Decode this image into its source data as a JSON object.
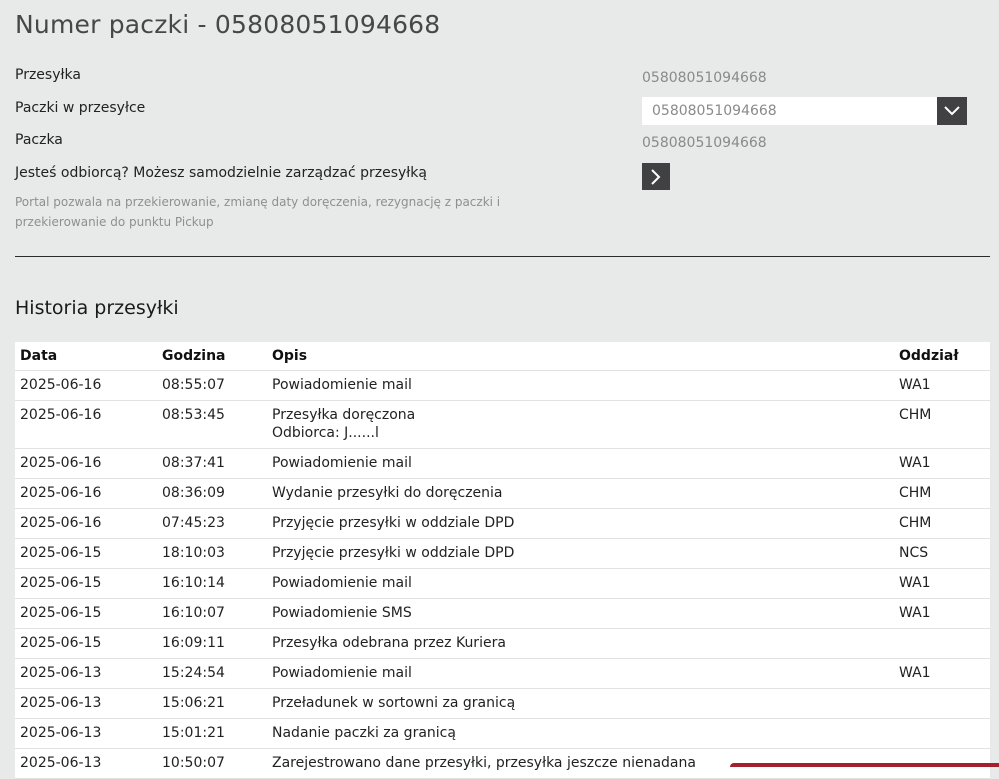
{
  "header": {
    "title": "Numer paczki - 05808051094668"
  },
  "info": {
    "shipment_label": "Przesyłka",
    "shipment_value": "05808051094668",
    "parcels_label": "Paczki w przesyłce",
    "parcels_selected": "05808051094668",
    "parcel_label": "Paczka",
    "parcel_value": "05808051094668",
    "recipient_label": "Jesteś odbiorcą? Możesz samodzielnie zarządzać przesyłką",
    "hint": "Portal pozwala na przekierowanie, zmianę daty doręczenia, rezygnację z paczki i przekierowanie do punktu Pickup"
  },
  "history": {
    "title": "Historia przesyłki",
    "columns": {
      "date": "Data",
      "time": "Godzina",
      "desc": "Opis",
      "branch": "Oddział"
    },
    "rows": [
      {
        "date": "2025-06-16",
        "time": "08:55:07",
        "desc": "Powiadomienie mail",
        "desc2": "",
        "branch": "WA1"
      },
      {
        "date": "2025-06-16",
        "time": "08:53:45",
        "desc": "Przesyłka doręczona",
        "desc2": "Odbiorca: J......l",
        "branch": "CHM"
      },
      {
        "date": "2025-06-16",
        "time": "08:37:41",
        "desc": "Powiadomienie mail",
        "desc2": "",
        "branch": "WA1"
      },
      {
        "date": "2025-06-16",
        "time": "08:36:09",
        "desc": "Wydanie przesyłki do doręczenia",
        "desc2": "",
        "branch": "CHM"
      },
      {
        "date": "2025-06-16",
        "time": "07:45:23",
        "desc": "Przyjęcie przesyłki w oddziale DPD",
        "desc2": "",
        "branch": "CHM"
      },
      {
        "date": "2025-06-15",
        "time": "18:10:03",
        "desc": "Przyjęcie przesyłki w oddziale DPD",
        "desc2": "",
        "branch": "NCS"
      },
      {
        "date": "2025-06-15",
        "time": "16:10:14",
        "desc": "Powiadomienie mail",
        "desc2": "",
        "branch": "WA1"
      },
      {
        "date": "2025-06-15",
        "time": "16:10:07",
        "desc": "Powiadomienie SMS",
        "desc2": "",
        "branch": "WA1"
      },
      {
        "date": "2025-06-15",
        "time": "16:09:11",
        "desc": "Przesyłka odebrana przez Kuriera",
        "desc2": "",
        "branch": ""
      },
      {
        "date": "2025-06-13",
        "time": "15:24:54",
        "desc": "Powiadomienie mail",
        "desc2": "",
        "branch": "WA1"
      },
      {
        "date": "2025-06-13",
        "time": "15:06:21",
        "desc": "Przeładunek w sortowni za granicą",
        "desc2": "",
        "branch": ""
      },
      {
        "date": "2025-06-13",
        "time": "15:01:21",
        "desc": "Nadanie paczki za granicą",
        "desc2": "",
        "branch": ""
      },
      {
        "date": "2025-06-13",
        "time": "10:50:07",
        "desc": "Zarejestrowano dane przesyłki, przesyłka jeszcze nienadana",
        "desc2": "",
        "branch": ""
      }
    ]
  },
  "icons": {
    "dropdown": "chevron-down-icon",
    "manage": "chevron-right-icon"
  },
  "colors": {
    "button_bg": "#414042",
    "accent_bar": "#a3202c"
  }
}
